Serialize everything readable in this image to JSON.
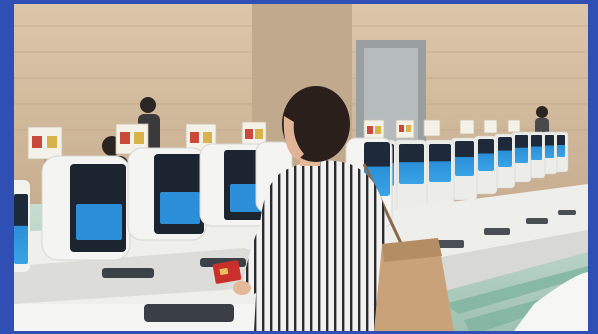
{
  "scene": {
    "border_color": "#2f4fb5",
    "wall_color": "#d9c3a8",
    "floor_color": "#b9d3c6",
    "kiosk_body": "#f3f3f1",
    "kiosk_screen": "#2a8fd8",
    "sign_color": "#f4f1e8",
    "sign_accent": "#c94a3b",
    "shirt_stripe": "#2b2b2b",
    "bag_color": "#c9a27a",
    "passport_color": "#c9302c"
  }
}
